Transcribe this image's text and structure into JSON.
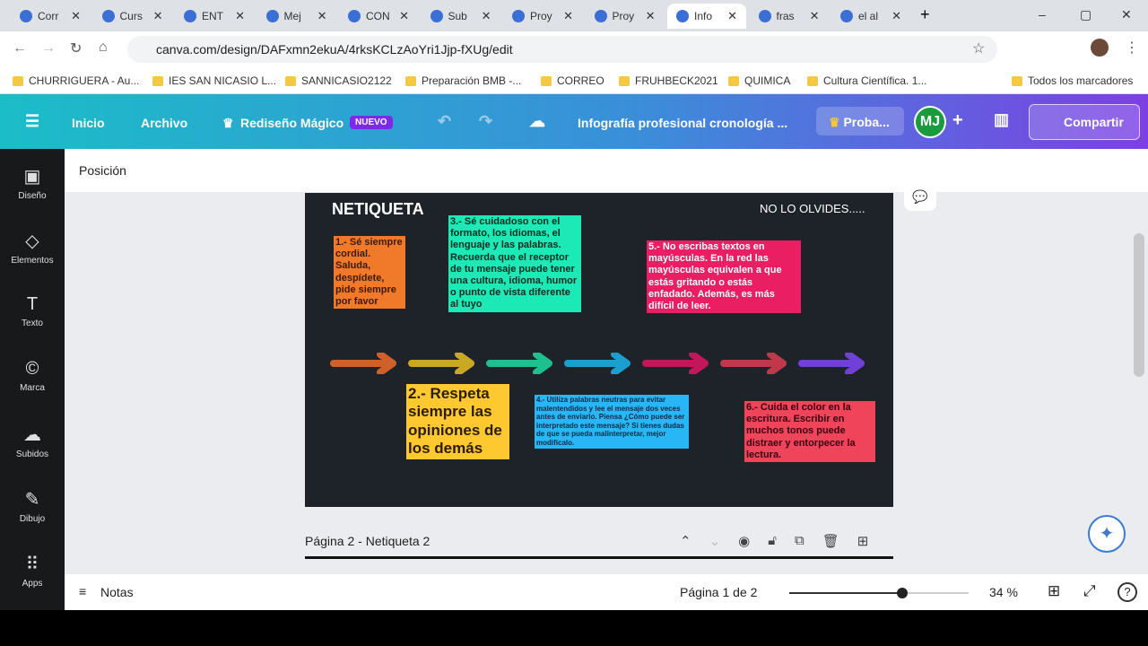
{
  "browser": {
    "tabs": [
      "Corr",
      "Curs",
      "ENT",
      "Mej",
      "CON",
      "Sub",
      "Proy",
      "Proy",
      "Info",
      "fras",
      "el al"
    ],
    "active_tab": 8,
    "url": "canva.com/design/DAFxmn2ekuA/4rksKCLzAoYri1Jjp-fXUg/edit",
    "bookmarks": [
      "CHURRIGUERA - Au...",
      "IES SAN NICASIO L...",
      "SANNICASIO2122",
      "Preparación BMB -...",
      "CORREO",
      "FRUHBECK2021",
      "QUIMICA",
      "Cultura Científica. 1..."
    ],
    "all_bookmarks": "Todos los marcadores"
  },
  "header": {
    "inicio": "Inicio",
    "archivo": "Archivo",
    "magic": "Rediseño Mágico",
    "nuevo": "NUEVO",
    "title": "Infografía profesional cronología ...",
    "proba": "Proba...",
    "avatar": "MJ",
    "share": "Compartir"
  },
  "sidebar": [
    {
      "label": "Diseño",
      "icon": "▣"
    },
    {
      "label": "Elementos",
      "icon": "◇"
    },
    {
      "label": "Texto",
      "icon": "T"
    },
    {
      "label": "Marca",
      "icon": "©"
    },
    {
      "label": "Subidos",
      "icon": "☁"
    },
    {
      "label": "Dibujo",
      "icon": "✎"
    },
    {
      "label": "Apps",
      "icon": "⠿"
    }
  ],
  "toolbar": {
    "position": "Posición"
  },
  "design": {
    "title": "NETIQUETA",
    "subtitle": "NO LO OLVIDES.....",
    "items": [
      {
        "text": "1.- Sé siempre cordial. Saluda, despídete, pide siempre por favor",
        "color": "#f07a2a"
      },
      {
        "text": "2.- Respeta siempre las opiniones de los demás",
        "color": "#fdc830"
      },
      {
        "text": "3.- Sé cuidadoso con el formato, los idiomas, el lenguaje y las palabras. Recuerda que el receptor de tu mensaje puede tener una cultura, idioma, humor o punto de vista diferente al tuyo",
        "color": "#1de9b6"
      },
      {
        "text": "4.- Utiliza palabras neutras para evitar malentendidos y lee el mensaje dos veces antes de enviarlo. Piensa ¿Cómo puede ser interpretado este mensaje? Si tienes dudas de que se pueda malinterpretar, mejor modifícalo.",
        "color": "#29b6f6"
      },
      {
        "text": "5.- No escribas textos en mayúsculas. En la red las mayúsculas equivalen a que estás gritando o estás enfadado. Además, es más difícil de leer.",
        "color": "#e91e63"
      },
      {
        "text": "6.- Cuida el color en la escritura. Escribir en muchos tonos puede distraer y entorpecer la lectura.",
        "color": "#f0445a"
      }
    ],
    "arrow_colors": [
      "#d0602a",
      "#c9a824",
      "#1fbf8f",
      "#1b9fcf",
      "#c2185b",
      "#c0394b",
      "#7040d8"
    ]
  },
  "page": {
    "label": "Página 2 - Netiqueta 2"
  },
  "bottom": {
    "notes": "Notas",
    "page_count": "Página 1 de 2",
    "zoom": "34 %",
    "zoom_value": 34
  }
}
